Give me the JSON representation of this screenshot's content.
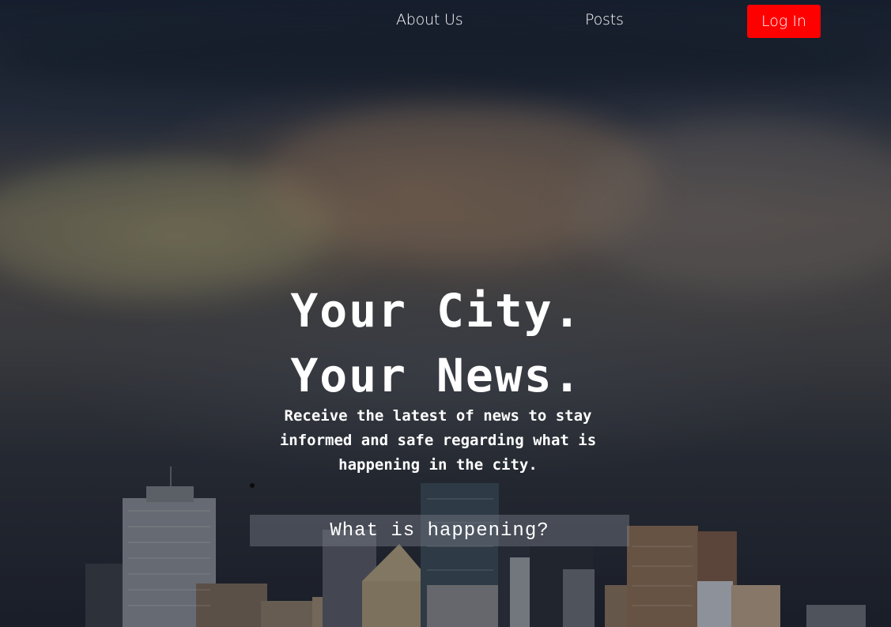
{
  "nav": {
    "about_label": "About Us",
    "posts_label": "Posts",
    "login_label": "Log In"
  },
  "hero": {
    "headline_line1": "Your City.",
    "headline_line2": "Your News.",
    "subtext": "Receive the latest of news to stay informed and safe regarding what is happening in the city."
  },
  "search": {
    "placeholder": "What is happening?"
  },
  "colors": {
    "accent": "#ff0000",
    "text": "#ffffff"
  }
}
